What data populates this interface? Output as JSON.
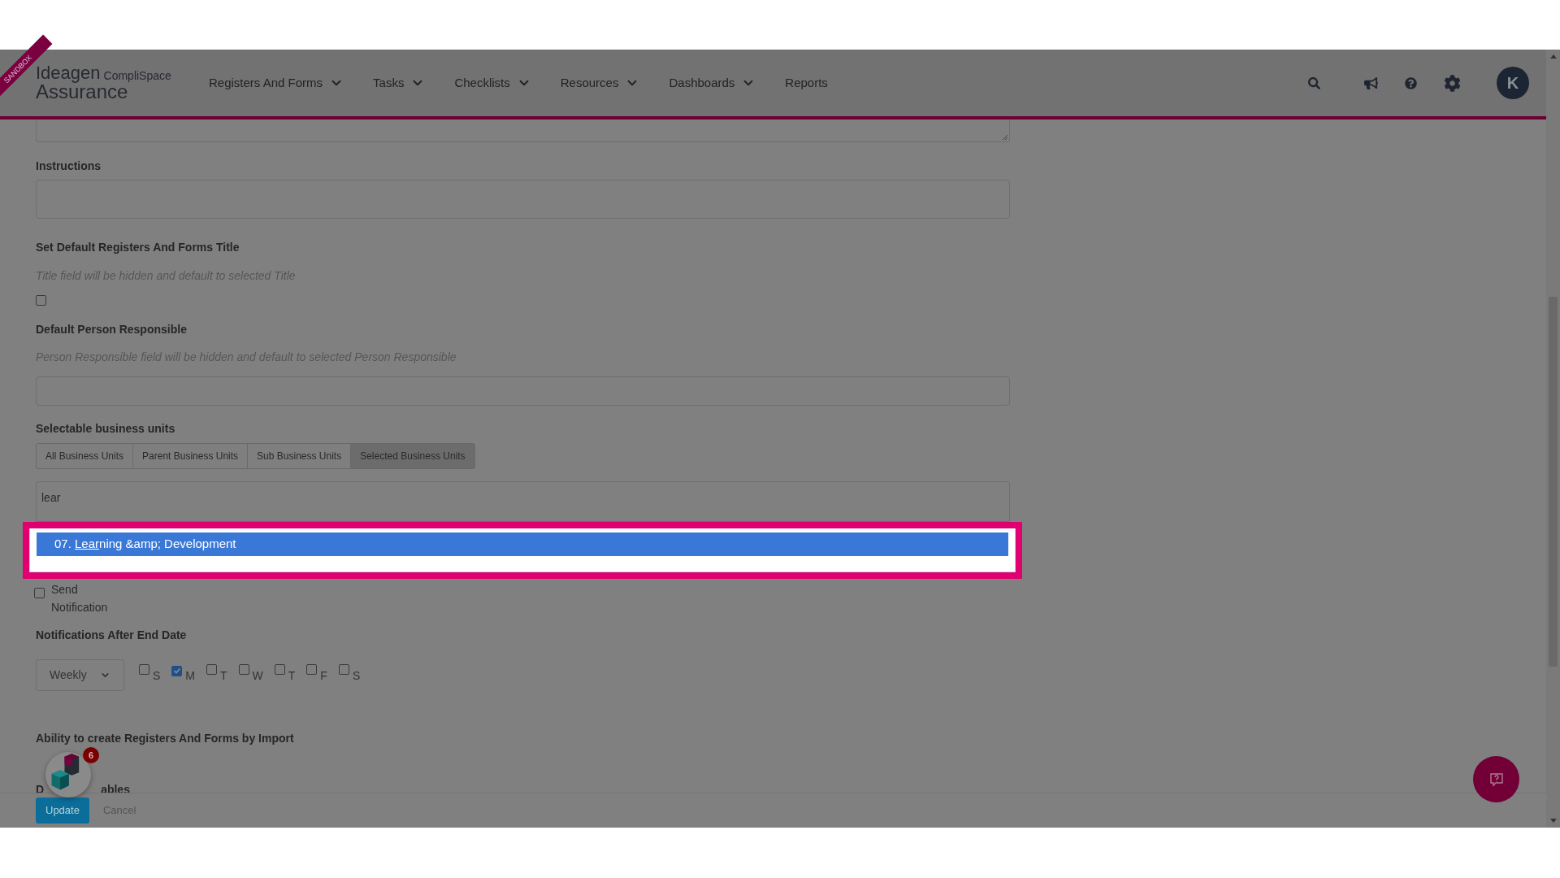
{
  "header": {
    "ribbon": "SANDBOX",
    "logo": {
      "brand": "Ideagen",
      "sub": "CompliSpace",
      "product": "Assurance"
    },
    "nav": [
      {
        "label": "Registers And Forms",
        "dropdown": true
      },
      {
        "label": "Tasks",
        "dropdown": true
      },
      {
        "label": "Checklists",
        "dropdown": true
      },
      {
        "label": "Resources",
        "dropdown": true
      },
      {
        "label": "Dashboards",
        "dropdown": true
      },
      {
        "label": "Reports",
        "dropdown": false
      }
    ],
    "avatar": "K"
  },
  "form": {
    "instructions": {
      "label": "Instructions"
    },
    "default_title": {
      "label": "Set Default Registers And Forms Title",
      "hint": "Title field will be hidden and default to selected Title",
      "checked": false
    },
    "default_person": {
      "label": "Default Person Responsible",
      "hint": "Person Responsible field will be hidden and default to selected Person Responsible"
    },
    "business_units": {
      "label": "Selectable business units",
      "tabs": [
        {
          "label": "All Business Units",
          "selected": false
        },
        {
          "label": "Parent Business Units",
          "selected": false
        },
        {
          "label": "Sub Business Units",
          "selected": false
        },
        {
          "label": "Selected Business Units",
          "selected": true
        }
      ],
      "search": {
        "value": "lear"
      },
      "options": [
        {
          "before": "07. ",
          "match": "Lear",
          "after": "ning &amp; Development",
          "selected": true
        }
      ]
    },
    "send_notification": {
      "label_first": "Send",
      "label_second": "Notification",
      "checked": false
    },
    "notifications_after_end_date": {
      "label": "Notifications After End Date",
      "frequency": "Weekly",
      "days": [
        {
          "label": "S",
          "checked": false
        },
        {
          "label": "M",
          "checked": true
        },
        {
          "label": "T",
          "checked": false
        },
        {
          "label": "W",
          "checked": false
        },
        {
          "label": "T",
          "checked": false
        },
        {
          "label": "F",
          "checked": false
        },
        {
          "label": "S",
          "checked": false
        }
      ]
    },
    "import": {
      "label": "Ability to create Registers And Forms by Import"
    },
    "section_5": {
      "label_start": "D",
      "label_end": "ables"
    }
  },
  "widget": {
    "badge": "6"
  },
  "footer": {
    "buttons": [
      {
        "label": "Update",
        "kind": "primary"
      },
      {
        "label": "Cancel",
        "kind": "link"
      }
    ]
  }
}
